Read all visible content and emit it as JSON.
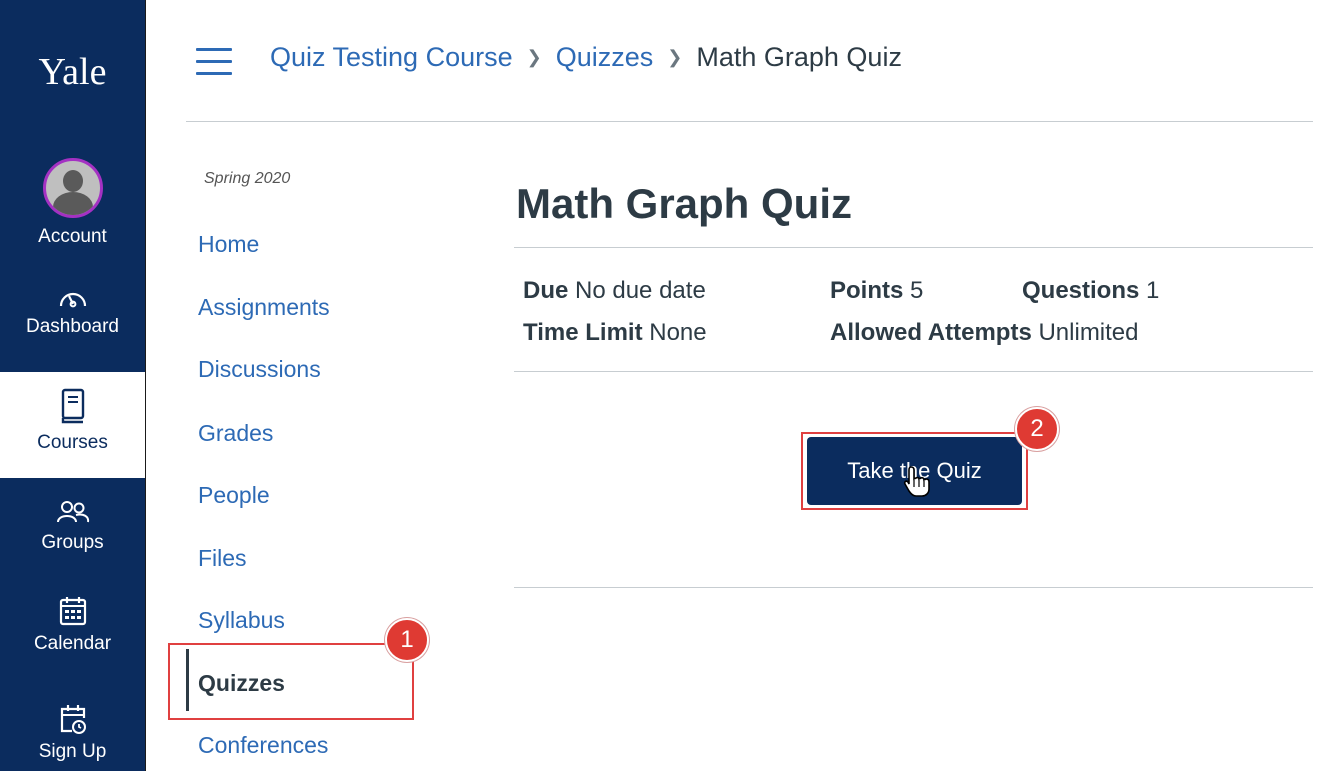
{
  "global_nav": {
    "logo": "Yale",
    "items": [
      {
        "label": "Account",
        "icon": "avatar-icon"
      },
      {
        "label": "Dashboard",
        "icon": "dashboard-gauge-icon"
      },
      {
        "label": "Courses",
        "icon": "book-icon",
        "active": true
      },
      {
        "label": "Groups",
        "icon": "groups-icon"
      },
      {
        "label": "Calendar",
        "icon": "calendar-icon"
      },
      {
        "label": "Sign Up",
        "icon": "calendar-clock-icon"
      }
    ]
  },
  "header": {
    "menu_icon": "hamburger-icon",
    "breadcrumbs": [
      "Quiz Testing Course",
      "Quizzes",
      "Math Graph Quiz"
    ]
  },
  "course_nav": {
    "term": "Spring 2020",
    "items": [
      "Home",
      "Assignments",
      "Discussions",
      "Grades",
      "People",
      "Files",
      "Syllabus",
      "Quizzes",
      "Conferences"
    ],
    "active": "Quizzes"
  },
  "quiz": {
    "title": "Math Graph Quiz",
    "due_label": "Due",
    "due_value": "No due date",
    "points_label": "Points",
    "points_value": "5",
    "questions_label": "Questions",
    "questions_value": "1",
    "time_limit_label": "Time Limit",
    "time_limit_value": "None",
    "attempts_label": "Allowed Attempts",
    "attempts_value": "Unlimited",
    "take_button": "Take the Quiz"
  },
  "annotations": {
    "step1": "1",
    "step2": "2",
    "accent_color": "#df3a33"
  },
  "colors": {
    "nav_bg": "#0b2c5e",
    "link": "#2d6ab5",
    "text": "#2d3b45"
  }
}
